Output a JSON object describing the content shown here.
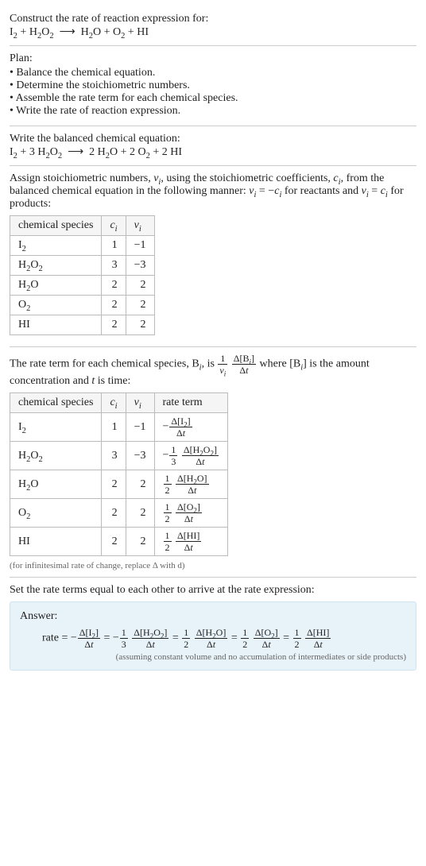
{
  "intro": {
    "title": "Construct the rate of reaction expression for:",
    "equation_html": "I<sub>2</sub> + H<sub>2</sub>O<sub>2</sub> &nbsp;⟶&nbsp; H<sub>2</sub>O + O<sub>2</sub> + HI"
  },
  "plan": {
    "label": "Plan:",
    "items": [
      "Balance the chemical equation.",
      "Determine the stoichiometric numbers.",
      "Assemble the rate term for each chemical species.",
      "Write the rate of reaction expression."
    ]
  },
  "balanced": {
    "label": "Write the balanced chemical equation:",
    "equation_html": "I<sub>2</sub> + 3 H<sub>2</sub>O<sub>2</sub> &nbsp;⟶&nbsp; 2 H<sub>2</sub>O + 2 O<sub>2</sub> + 2 HI"
  },
  "stoich": {
    "text_html": "Assign stoichiometric numbers, <i>ν<sub>i</sub></i>, using the stoichiometric coefficients, <i>c<sub>i</sub></i>, from the balanced chemical equation in the following manner: <i>ν<sub>i</sub></i> = −<i>c<sub>i</sub></i> for reactants and <i>ν<sub>i</sub></i> = <i>c<sub>i</sub></i> for products:",
    "headers": [
      "chemical species",
      "c_i",
      "ν_i"
    ],
    "header_html": [
      "chemical species",
      "<i>c<sub>i</sub></i>",
      "<i>ν<sub>i</sub></i>"
    ],
    "rows": [
      {
        "species_html": "I<sub>2</sub>",
        "c": 1,
        "nu": -1
      },
      {
        "species_html": "H<sub>2</sub>O<sub>2</sub>",
        "c": 3,
        "nu": -3
      },
      {
        "species_html": "H<sub>2</sub>O",
        "c": 2,
        "nu": 2
      },
      {
        "species_html": "O<sub>2</sub>",
        "c": 2,
        "nu": 2
      },
      {
        "species_html": "HI",
        "c": 2,
        "nu": 2
      }
    ]
  },
  "rateterm": {
    "text_html": "The rate term for each chemical species, B<sub><i>i</i></sub>, is <span class=\"frac\"><span class=\"n\">1</span><span class=\"d\"><i>ν<sub>i</sub></i></span></span> <span class=\"frac\"><span class=\"n\">Δ[B<sub><i>i</i></sub>]</span><span class=\"d\">Δ<i>t</i></span></span> where [B<sub><i>i</i></sub>] is the amount concentration and <i>t</i> is time:",
    "headers": [
      "chemical species",
      "c_i",
      "ν_i",
      "rate term"
    ],
    "header_html": [
      "chemical species",
      "<i>c<sub>i</sub></i>",
      "<i>ν<sub>i</sub></i>",
      "rate term"
    ],
    "rows": [
      {
        "species_html": "I<sub>2</sub>",
        "c": 1,
        "nu": -1,
        "rate_html": "−<span class=\"frac\"><span class=\"n\">Δ[I<sub>2</sub>]</span><span class=\"d\">Δ<i>t</i></span></span>"
      },
      {
        "species_html": "H<sub>2</sub>O<sub>2</sub>",
        "c": 3,
        "nu": -3,
        "rate_html": "−<span class=\"frac\"><span class=\"n\">1</span><span class=\"d\">3</span></span> <span class=\"frac\"><span class=\"n\">Δ[H<sub>2</sub>O<sub>2</sub>]</span><span class=\"d\">Δ<i>t</i></span></span>"
      },
      {
        "species_html": "H<sub>2</sub>O",
        "c": 2,
        "nu": 2,
        "rate_html": "<span class=\"frac\"><span class=\"n\">1</span><span class=\"d\">2</span></span> <span class=\"frac\"><span class=\"n\">Δ[H<sub>2</sub>O]</span><span class=\"d\">Δ<i>t</i></span></span>"
      },
      {
        "species_html": "O<sub>2</sub>",
        "c": 2,
        "nu": 2,
        "rate_html": "<span class=\"frac\"><span class=\"n\">1</span><span class=\"d\">2</span></span> <span class=\"frac\"><span class=\"n\">Δ[O<sub>2</sub>]</span><span class=\"d\">Δ<i>t</i></span></span>"
      },
      {
        "species_html": "HI",
        "c": 2,
        "nu": 2,
        "rate_html": "<span class=\"frac\"><span class=\"n\">1</span><span class=\"d\">2</span></span> <span class=\"frac\"><span class=\"n\">Δ[HI]</span><span class=\"d\">Δ<i>t</i></span></span>"
      }
    ],
    "note": "(for infinitesimal rate of change, replace Δ with d)"
  },
  "final": {
    "label": "Set the rate terms equal to each other to arrive at the rate expression:"
  },
  "answer": {
    "label": "Answer:",
    "expr_html": "rate = −<span class=\"frac\"><span class=\"n\">Δ[I<sub>2</sub>]</span><span class=\"d\">Δ<i>t</i></span></span> = −<span class=\"frac\"><span class=\"n\">1</span><span class=\"d\">3</span></span> <span class=\"frac\"><span class=\"n\">Δ[H<sub>2</sub>O<sub>2</sub>]</span><span class=\"d\">Δ<i>t</i></span></span> = <span class=\"frac\"><span class=\"n\">1</span><span class=\"d\">2</span></span> <span class=\"frac\"><span class=\"n\">Δ[H<sub>2</sub>O]</span><span class=\"d\">Δ<i>t</i></span></span> = <span class=\"frac\"><span class=\"n\">1</span><span class=\"d\">2</span></span> <span class=\"frac\"><span class=\"n\">Δ[O<sub>2</sub>]</span><span class=\"d\">Δ<i>t</i></span></span> = <span class=\"frac\"><span class=\"n\">1</span><span class=\"d\">2</span></span> <span class=\"frac\"><span class=\"n\">Δ[HI]</span><span class=\"d\">Δ<i>t</i></span></span>",
    "note": "(assuming constant volume and no accumulation of intermediates or side products)"
  }
}
